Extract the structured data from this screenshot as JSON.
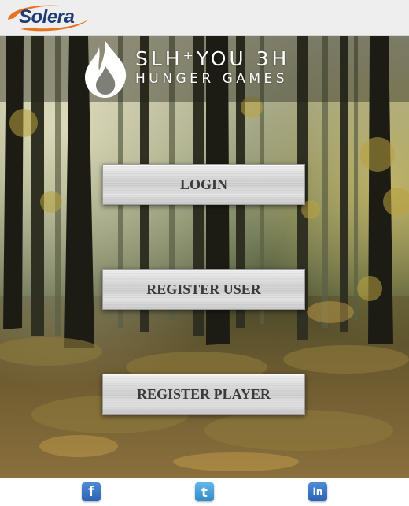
{
  "header": {
    "brand_name": "Solera",
    "brand_color": "#1f3b73",
    "swoosh_color": "#e8731e"
  },
  "logo": {
    "line1": "SLH⁺YOU 3H",
    "line2": "HUNGER GAMES",
    "icon": "flame-icon"
  },
  "menu": {
    "login_label": "LOGIN",
    "register_user_label": "REGISTER USER",
    "register_player_label": "REGISTER PLAYER"
  },
  "footer": {
    "facebook_glyph": "f",
    "twitter_glyph": "t",
    "linkedin_glyph": "in"
  }
}
